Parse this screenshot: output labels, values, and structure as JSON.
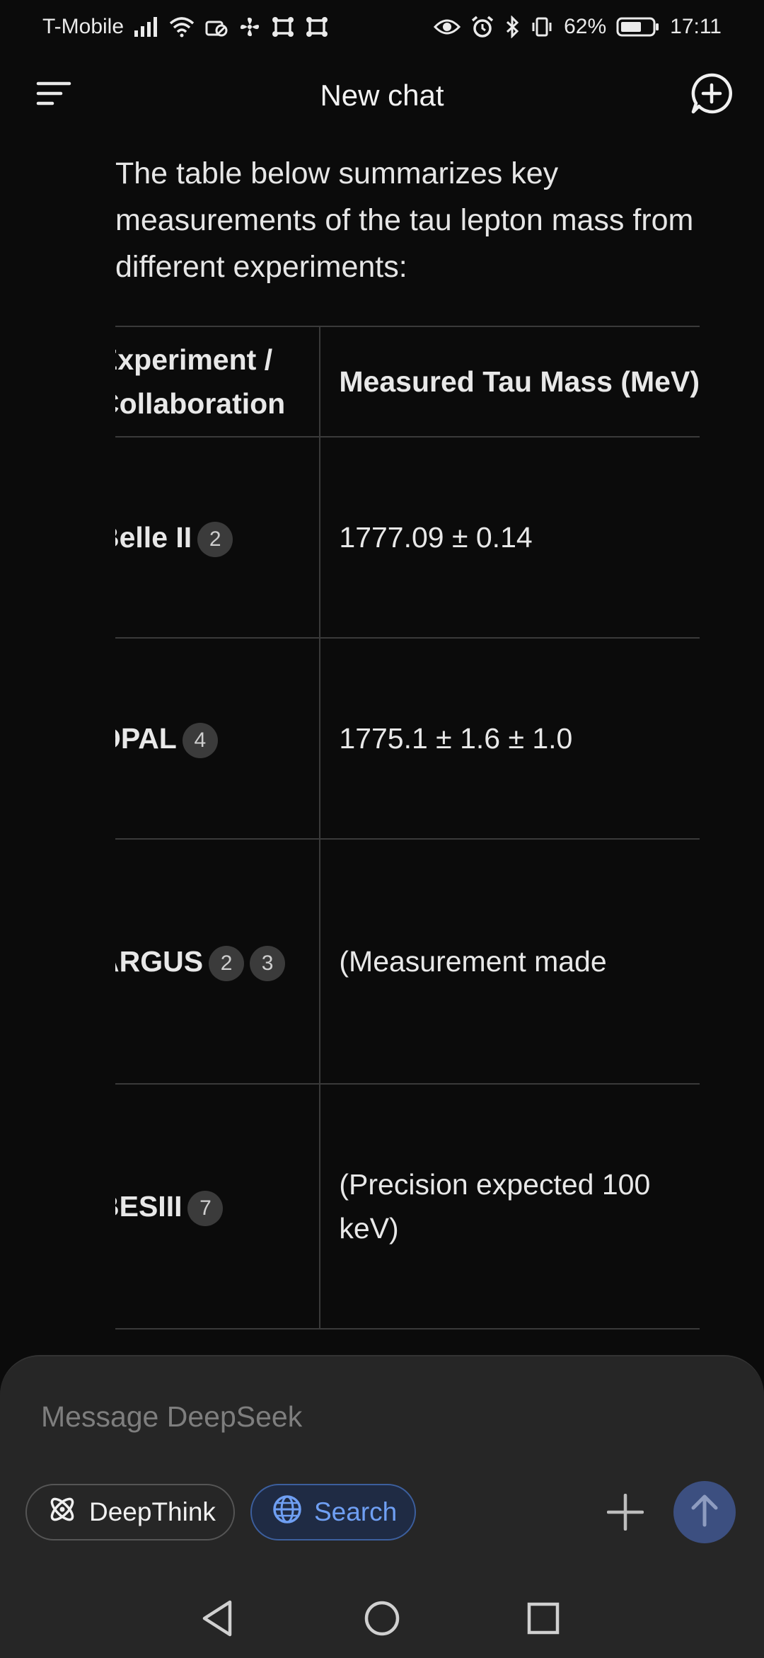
{
  "status_bar": {
    "carrier": "T-Mobile",
    "battery_percent": "62%",
    "time": "17:11"
  },
  "app_bar": {
    "title": "New chat"
  },
  "message": {
    "intro": "The table below summarizes key measurements of the tau lepton mass from different experiments:",
    "table": {
      "headers": [
        "Experiment / Collaboration",
        "Measured Tau Mass (MeV)"
      ],
      "rows": [
        {
          "experiment": "Belle II",
          "citations": [
            "2"
          ],
          "mass": "1777.09 ± 0.14"
        },
        {
          "experiment": "OPAL",
          "citations": [
            "4"
          ],
          "mass": "1775.1 ± 1.6 ± 1.0"
        },
        {
          "experiment": "ARGUS",
          "citations": [
            "2",
            "3"
          ],
          "mass": "(Measurement made"
        },
        {
          "experiment": "BESIII",
          "citations": [
            "7"
          ],
          "mass": "(Precision expected 100 keV)"
        }
      ]
    }
  },
  "composer": {
    "placeholder": "Message DeepSeek",
    "deepthink_label": "DeepThink",
    "search_label": "Search"
  },
  "colors": {
    "background": "#0b0b0b",
    "composer": "#262626",
    "search_accent": "#6f9ff3",
    "send_button": "#3c4f80"
  }
}
